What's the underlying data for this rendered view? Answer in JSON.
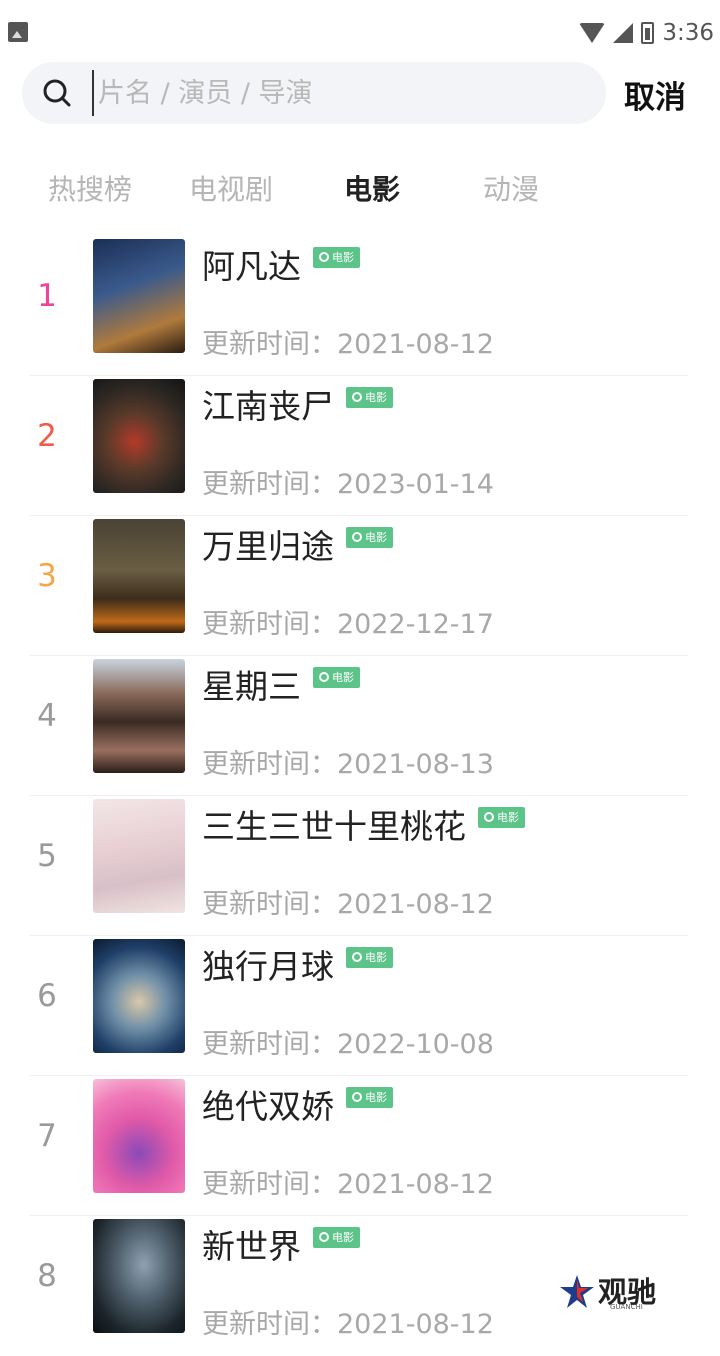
{
  "status_bar": {
    "time": "3:36",
    "left_icon": "image-icon",
    "icons": [
      "wifi-icon",
      "signal-icon",
      "battery-icon"
    ]
  },
  "search": {
    "placeholder": "片名 / 演员 / 导演",
    "value": "",
    "cancel_label": "取消",
    "icon": "search-icon"
  },
  "tabs": [
    {
      "label": "热搜榜",
      "active": false
    },
    {
      "label": "电视剧",
      "active": false
    },
    {
      "label": "电影",
      "active": true
    },
    {
      "label": "动漫",
      "active": false
    }
  ],
  "colors": {
    "rank_1": "#f0449b",
    "rank_2": "#f25a4a",
    "rank_3": "#f5a64a",
    "rank_default": "#9a9a9a",
    "tag_bg": "#5cc489"
  },
  "list": [
    {
      "rank": "1",
      "title": "阿凡达",
      "tag": "电影",
      "updated": "更新时间：2021-08-12"
    },
    {
      "rank": "2",
      "title": "江南丧尸",
      "tag": "电影",
      "updated": "更新时间：2023-01-14"
    },
    {
      "rank": "3",
      "title": "万里归途",
      "tag": "电影",
      "updated": "更新时间：2022-12-17"
    },
    {
      "rank": "4",
      "title": "星期三",
      "tag": "电影",
      "updated": "更新时间：2021-08-13"
    },
    {
      "rank": "5",
      "title": "三生三世十里桃花",
      "tag": "电影",
      "updated": "更新时间：2021-08-12"
    },
    {
      "rank": "6",
      "title": "独行月球",
      "tag": "电影",
      "updated": "更新时间：2022-10-08"
    },
    {
      "rank": "7",
      "title": "绝代双娇",
      "tag": "电影",
      "updated": "更新时间：2021-08-12"
    },
    {
      "rank": "8",
      "title": "新世界",
      "tag": "电影",
      "updated": "更新时间：2021-08-12"
    }
  ],
  "watermark": {
    "text": "观驰",
    "sub": "GUANCHI"
  }
}
